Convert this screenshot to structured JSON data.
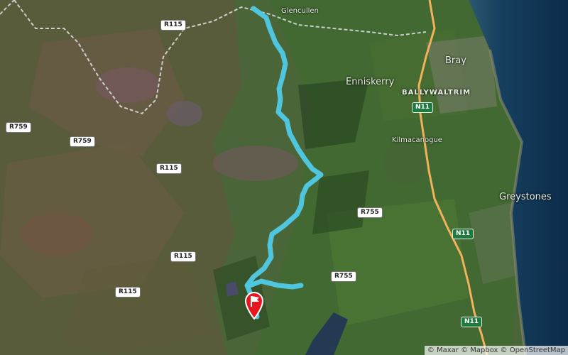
{
  "map": {
    "style": "satellite",
    "colors": {
      "route": "#4fc6dd",
      "county_border": "#d9d9d9",
      "motorway": "#f2b15c",
      "sea": "#123a5c",
      "marker": "#e8141e"
    },
    "places": [
      {
        "name": "Glencullen"
      },
      {
        "name": "Enniskerry"
      },
      {
        "name": "Bray"
      },
      {
        "name": "BALLYWALTRIM"
      },
      {
        "name": "Kilmacanogue"
      },
      {
        "name": "Greystones"
      }
    ],
    "road_shields": [
      {
        "ref": "R115",
        "type": "regional"
      },
      {
        "ref": "R759",
        "type": "regional"
      },
      {
        "ref": "R759",
        "type": "regional"
      },
      {
        "ref": "R115",
        "type": "regional"
      },
      {
        "ref": "R115",
        "type": "regional"
      },
      {
        "ref": "R115",
        "type": "regional"
      },
      {
        "ref": "R755",
        "type": "regional"
      },
      {
        "ref": "R755",
        "type": "regional"
      },
      {
        "ref": "N11",
        "type": "national"
      },
      {
        "ref": "N11",
        "type": "national"
      },
      {
        "ref": "N11",
        "type": "national"
      }
    ],
    "marker_icon": "flag-pin-icon",
    "attribution": "© Maxar © Mapbox © OpenStreetMap"
  }
}
